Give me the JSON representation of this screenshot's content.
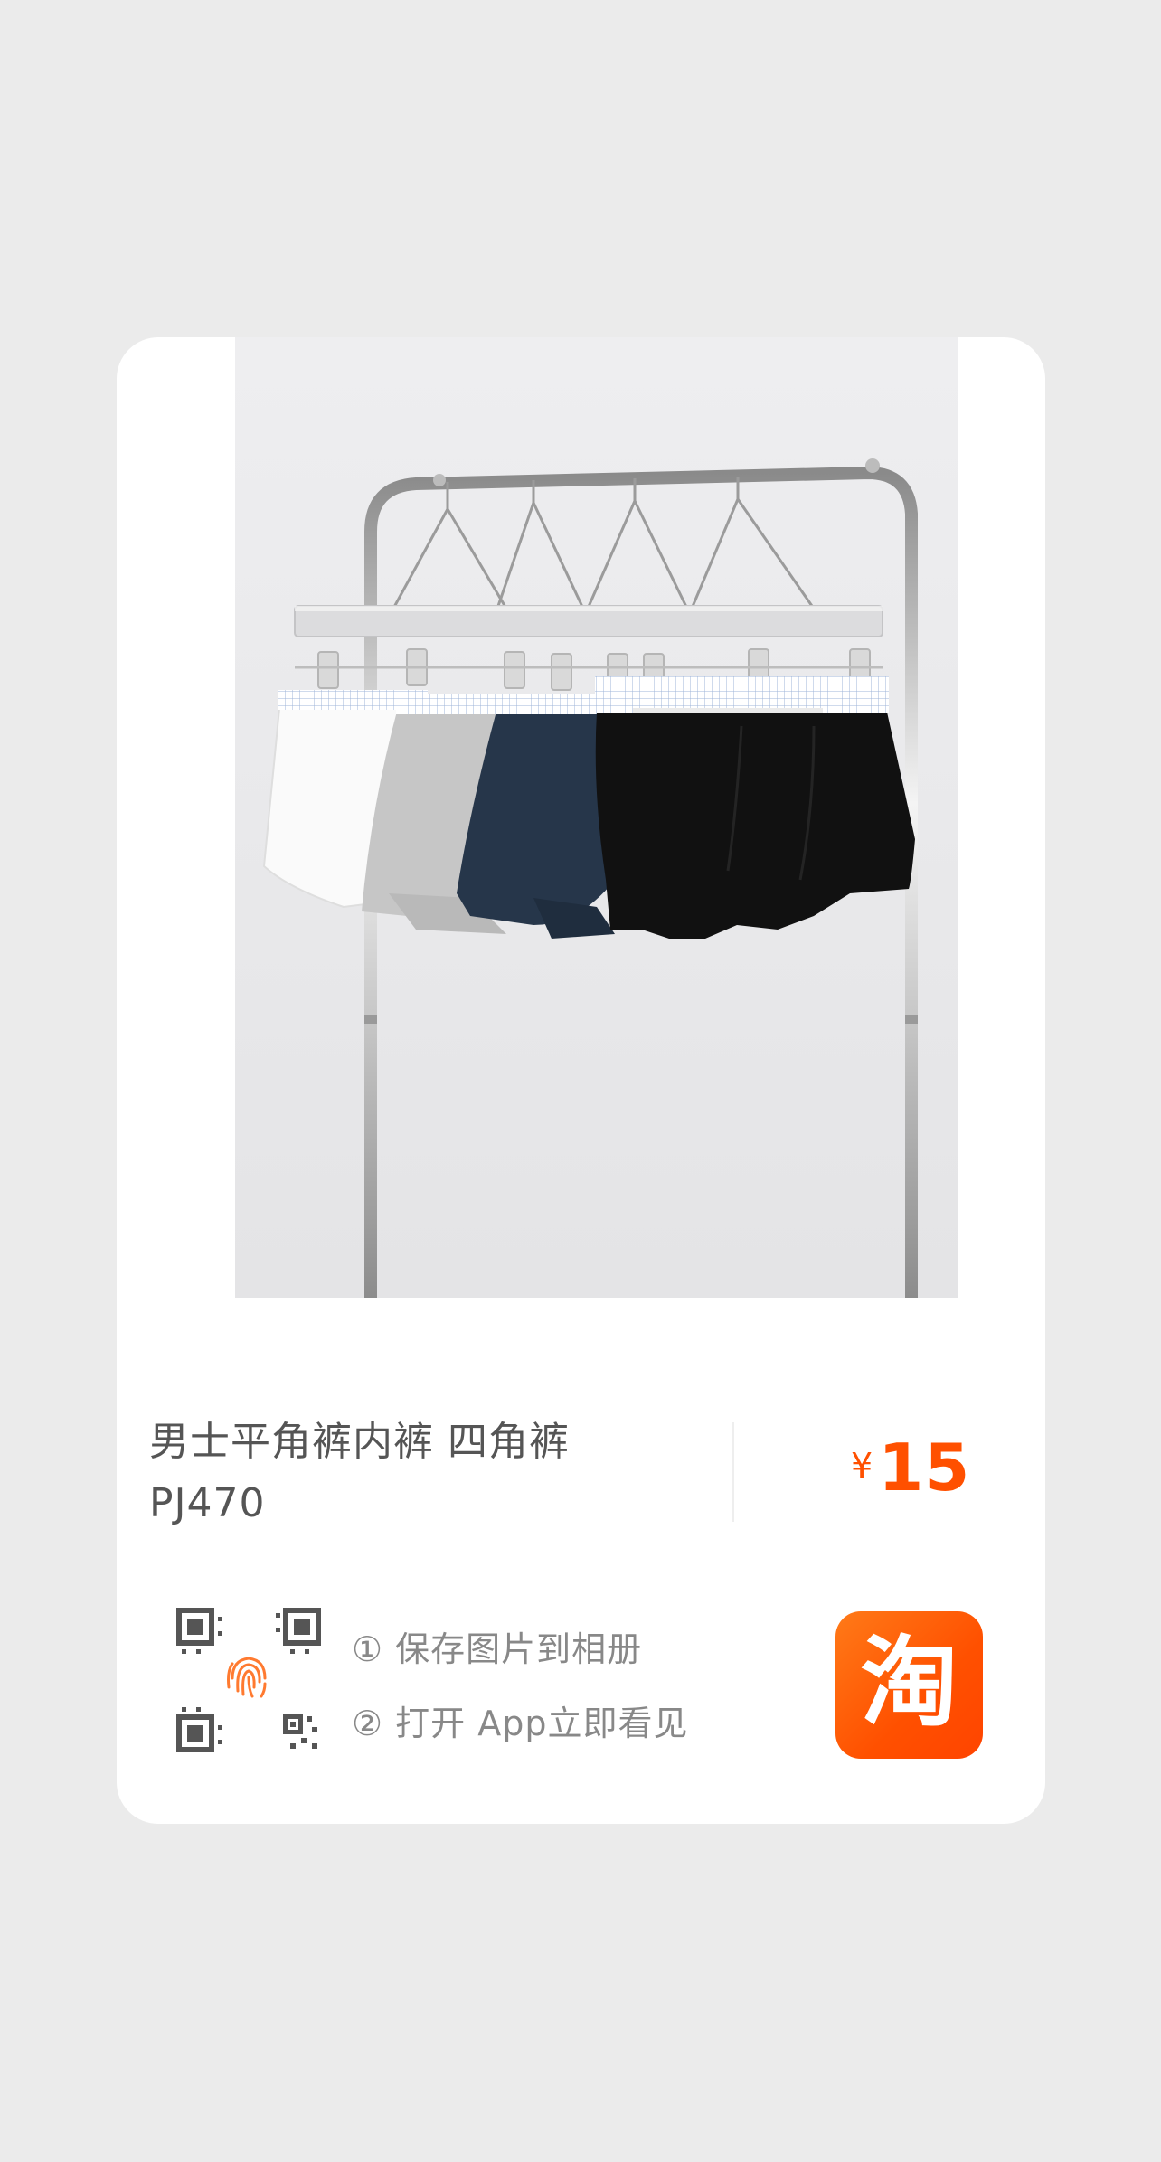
{
  "product": {
    "title_line1": "男士平角裤内裤 四角裤",
    "title_line2": "PJ470",
    "price_currency": "¥",
    "price_value": "15"
  },
  "instructions": {
    "step1": "① 保存图片到相册",
    "step2": "② 打开 App立即看见"
  },
  "app_icon": {
    "glyph": "淘",
    "icon": "taobao-app-icon"
  },
  "colors": {
    "accent": "#ff5000",
    "page_background": "#ebebeb",
    "card_background": "#ffffff"
  }
}
